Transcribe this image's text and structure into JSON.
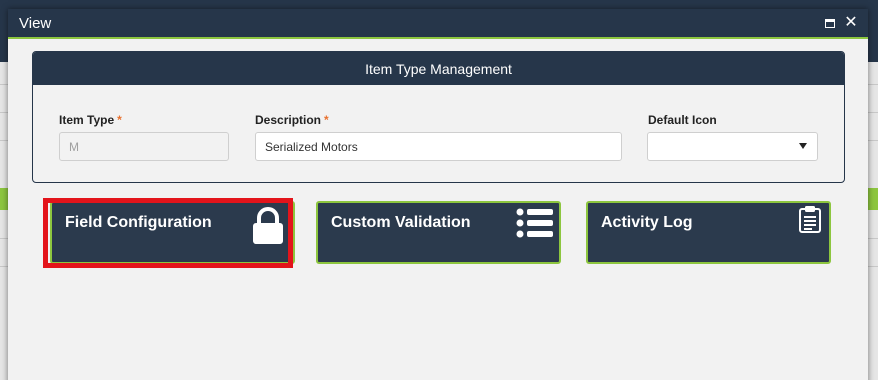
{
  "modal": {
    "title": "View",
    "maximize_icon": "maximize-icon",
    "close_icon": "close-icon"
  },
  "panel": {
    "title": "Item Type Management",
    "fields": {
      "item_type": {
        "label": "Item Type",
        "required_mark": "*",
        "value": "M"
      },
      "description": {
        "label": "Description",
        "required_mark": "*",
        "value": "Serialized Motors"
      },
      "default_icon": {
        "label": "Default Icon",
        "value": ""
      }
    }
  },
  "tiles": [
    {
      "label": "Field Configuration",
      "icon": "lock-icon",
      "highlighted": true
    },
    {
      "label": "Custom Validation",
      "icon": "list-icon"
    },
    {
      "label": "Activity Log",
      "icon": "clipboard-icon"
    }
  ],
  "colors": {
    "header_navy": "#26364a",
    "tile_navy": "#2b3a4d",
    "accent_green": "#8dc63f",
    "required_orange": "#e8712f",
    "highlight_red": "#e3141b"
  }
}
